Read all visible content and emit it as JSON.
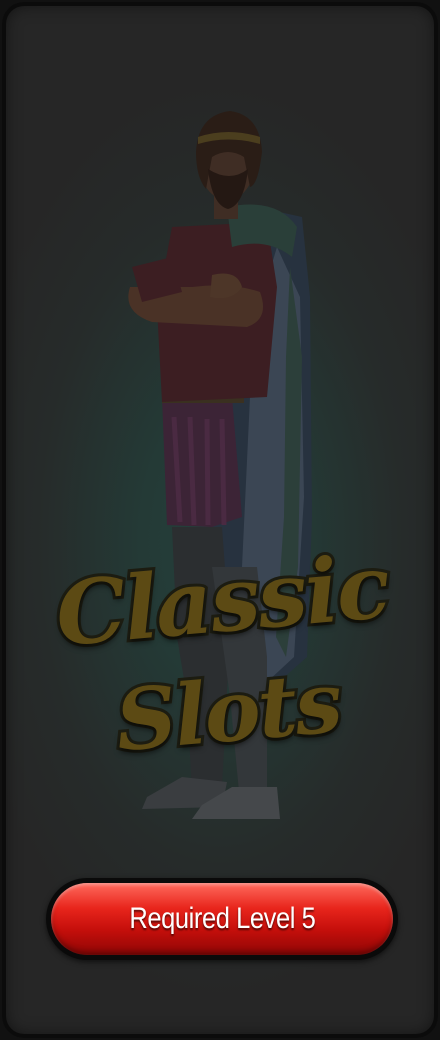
{
  "game_card": {
    "title_line1": "Classic",
    "title_line2": "Slots",
    "required_level_label": "Required Level 5",
    "character_icon": "bearded-king-character-icon",
    "locked_state": true,
    "colors": {
      "card_background": "#262626",
      "glow": "#23403c",
      "logo_gold": "#5c4a14",
      "button_red": "#e8251c",
      "button_text": "#ffffff"
    }
  }
}
